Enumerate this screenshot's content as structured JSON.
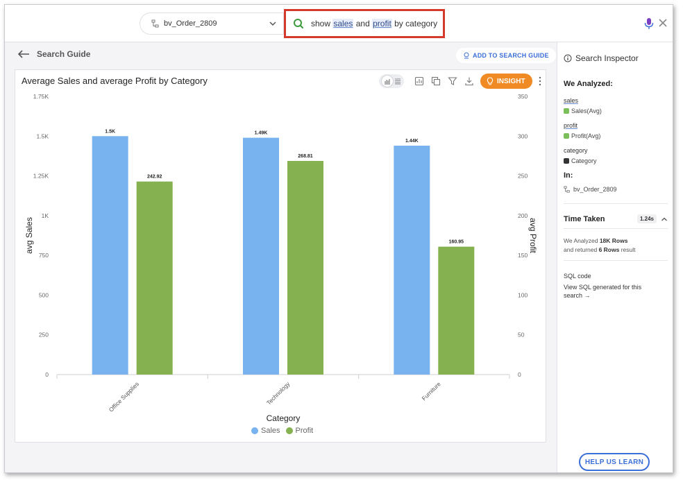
{
  "search": {
    "source": "bv_Order_2809",
    "tokens": [
      {
        "text": "show",
        "kind": "plain"
      },
      {
        "text": "sales",
        "kind": "keyword"
      },
      {
        "text": "and",
        "kind": "plain"
      },
      {
        "text": "profit",
        "kind": "keyword"
      },
      {
        "text": "by category",
        "kind": "plain"
      }
    ]
  },
  "nav": {
    "back_label": "Search Guide",
    "add_guide_label": "ADD TO SEARCH GUIDE"
  },
  "card": {
    "title": "Average Sales and average Profit by Category",
    "insight_label": "INSIGHT"
  },
  "chart_data": {
    "type": "bar",
    "title": "Average Sales and average Profit by Category",
    "categories": [
      "Office Supplies",
      "Technology",
      "Furniture"
    ],
    "xlabel": "Category",
    "ylabel": "avg Sales",
    "y2label": "avg Profit",
    "ylim": [
      0,
      1750
    ],
    "y2lim": [
      0,
      350
    ],
    "yticks": [
      "0",
      "250",
      "500",
      "750",
      "1K",
      "1.25K",
      "1.5K",
      "1.75K"
    ],
    "y2ticks": [
      "0",
      "50",
      "100",
      "150",
      "200",
      "250",
      "300",
      "350"
    ],
    "series": [
      {
        "name": "Sales",
        "axis": "left",
        "color": "#78b2ef",
        "values": [
          1500,
          1490,
          1440
        ],
        "labels": [
          "1.5K",
          "1.49K",
          "1.44K"
        ]
      },
      {
        "name": "Profit",
        "axis": "right",
        "color": "#86b150",
        "values": [
          242.92,
          268.81,
          160.95
        ],
        "labels": [
          "242.92",
          "268.81",
          "160.95"
        ]
      }
    ],
    "grid": false,
    "legend": "bottom"
  },
  "inspector": {
    "title": "Search Inspector",
    "analyzed_head": "We Analyzed:",
    "items": [
      {
        "keyword": "sales",
        "column": "Sales(Avg)",
        "badge_color": "#7cbf5a"
      },
      {
        "keyword": "profit",
        "column": "Profit(Avg)",
        "badge_color": "#7cbf5a"
      },
      {
        "keyword": "category",
        "column": "Category",
        "badge_color": "#333333"
      }
    ],
    "in_head": "In:",
    "in_source": "bv_Order_2809",
    "time_head": "Time Taken",
    "time_value": "1.24s",
    "analyzed_rows_pre": "We Analyzed ",
    "analyzed_rows": "18K Rows",
    "returned_pre": "and returned ",
    "returned_rows": "6 Rows",
    "returned_post": " result",
    "sql_head": "SQL code",
    "sql_link": "View SQL generated for this search →",
    "help_label": "HELP US LEARN"
  }
}
